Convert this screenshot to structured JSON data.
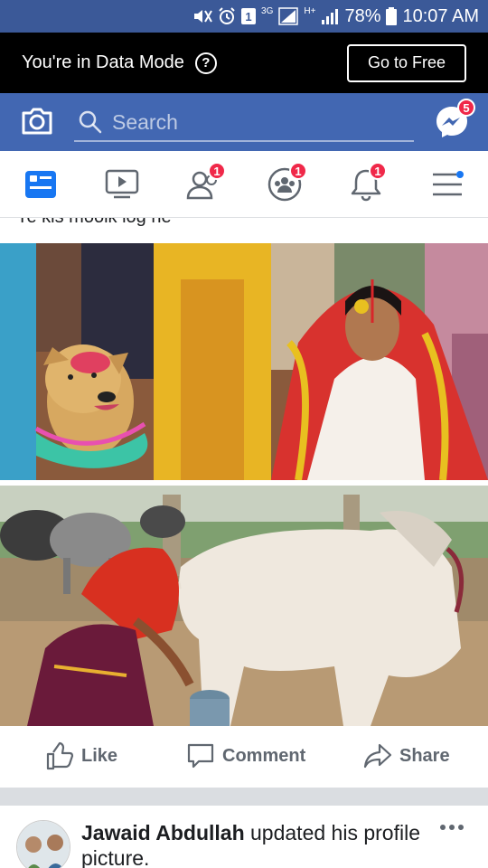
{
  "status_bar": {
    "network": "3G",
    "sim_slot": "1",
    "signal_type": "H+",
    "battery": "78%",
    "time": "10:07 AM"
  },
  "data_mode": {
    "message": "You're in Data Mode",
    "help_glyph": "?",
    "cta": "Go to Free"
  },
  "search": {
    "placeholder": "Search",
    "messenger_badge": "5"
  },
  "nav": {
    "friends_badge": "1",
    "groups_badge": "1",
    "notifications_badge": "1"
  },
  "post1": {
    "caption_clipped": "Ye kis moolk log he",
    "actions": {
      "like": "Like",
      "comment": "Comment",
      "share": "Share"
    }
  },
  "post2": {
    "author": "Jawaid Abdullah",
    "activity": " updated his profile picture."
  },
  "colors": {
    "fb_blue": "#4267b2",
    "status_blue": "#3b5998",
    "badge_red": "#f02849",
    "active_tab": "#1877f2"
  },
  "icons": [
    "mute-icon",
    "alarm-icon",
    "signal-icon",
    "battery-icon",
    "camera-icon",
    "search-icon",
    "messenger-icon",
    "news-feed-icon",
    "video-icon",
    "friends-icon",
    "groups-icon",
    "bell-icon",
    "menu-icon",
    "like-icon",
    "comment-icon",
    "share-icon",
    "more-icon"
  ]
}
